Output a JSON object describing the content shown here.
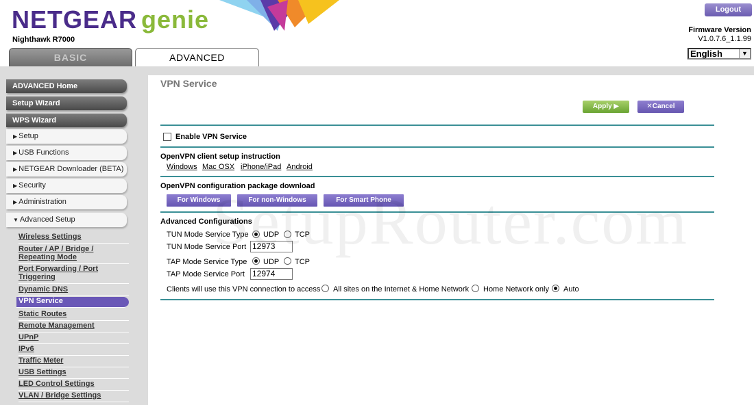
{
  "header": {
    "brand": "NETGEAR",
    "product": "genie",
    "model": "Nighthawk R7000",
    "tabs": [
      {
        "label": "BASIC"
      },
      {
        "label": "ADVANCED"
      }
    ],
    "logout_label": "Logout",
    "firmware_label": "Firmware Version",
    "firmware_value": "V1.0.7.6_1.1.99",
    "language": "English"
  },
  "sidebar": {
    "top_items": [
      {
        "label": "ADVANCED Home"
      },
      {
        "label": "Setup Wizard"
      },
      {
        "label": "WPS Wizard"
      }
    ],
    "sections": [
      {
        "label": "Setup"
      },
      {
        "label": "USB Functions"
      },
      {
        "label": "NETGEAR Downloader (BETA)"
      },
      {
        "label": "Security"
      },
      {
        "label": "Administration"
      },
      {
        "label": "Advanced Setup"
      }
    ],
    "sub_items": [
      {
        "label": "Wireless Settings"
      },
      {
        "label": "Router / AP / Bridge / Repeating Mode"
      },
      {
        "label": "Port Forwarding / Port Triggering"
      },
      {
        "label": "Dynamic DNS"
      },
      {
        "label": "VPN Service"
      },
      {
        "label": "Static Routes"
      },
      {
        "label": "Remote Management"
      },
      {
        "label": "UPnP"
      },
      {
        "label": "IPv6"
      },
      {
        "label": "Traffic Meter"
      },
      {
        "label": "USB Settings"
      },
      {
        "label": "LED Control Settings"
      },
      {
        "label": "VLAN / Bridge Settings"
      }
    ]
  },
  "main": {
    "title": "VPN Service",
    "apply_label": "Apply ▶",
    "cancel_label": "✕Cancel",
    "enable_label": "Enable VPN Service",
    "enable_checked": false,
    "client_setup": {
      "heading": "OpenVPN client setup instruction",
      "links": [
        "Windows",
        "Mac OSX",
        "iPhone/iPad",
        "Android"
      ]
    },
    "package_download": {
      "heading": "OpenVPN configuration package download",
      "buttons": [
        "For Windows",
        "For non-Windows",
        "For Smart Phone"
      ]
    },
    "advanced": {
      "heading": "Advanced Configurations",
      "tun_type_label": "TUN Mode Service Type",
      "tun_port_label": "TUN Mode Service Port",
      "tun_port_value": "12973",
      "tap_type_label": "TAP Mode Service Type",
      "tap_port_label": "TAP Mode Service Port",
      "tap_port_value": "12974",
      "udp_label": "UDP",
      "tcp_label": "TCP",
      "tun_selected": "UDP",
      "tap_selected": "UDP",
      "clients_label": "Clients will use this VPN connection to access",
      "access_options": [
        "All sites on the Internet & Home Network",
        "Home Network only",
        "Auto"
      ],
      "access_selected": "Auto"
    }
  },
  "watermark": "SetupRouter.com"
}
